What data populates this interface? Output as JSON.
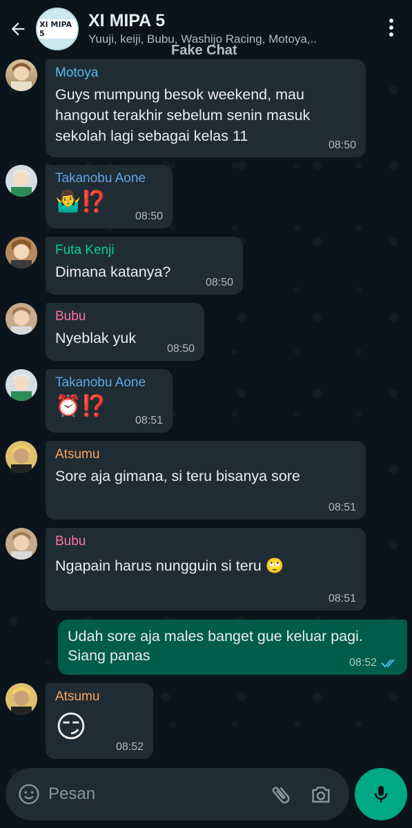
{
  "header": {
    "group_name": "XI MIPA 5",
    "members": "Yuuji, keiji, Bubu, Washijo Racing, Motoya,..",
    "avatar_text": "XI MIPA 5",
    "watermark": "Fake Chat"
  },
  "messages": [
    {
      "sender": "Motoya",
      "text": "Guys mumpung besok weekend, mau hangout terakhir sebelum senin masuk sekolah lagi sebagai kelas 11",
      "time": "08:50",
      "sender_color": "#53bdeb"
    },
    {
      "sender": "Takanobu Aone",
      "text": "🤷‍♂️⁉️",
      "time": "08:50",
      "sender_color": "#5ea4e6"
    },
    {
      "sender": "Futa Kenji",
      "text": "Dimana katanya?",
      "time": "08:50",
      "sender_color": "#06cf9c"
    },
    {
      "sender": "Bubu",
      "text": "Nyeblak yuk",
      "time": "08:50",
      "sender_color": "#ff72a1"
    },
    {
      "sender": "Takanobu Aone",
      "text": "⏰⁉️",
      "time": "08:51",
      "sender_color": "#5ea4e6"
    },
    {
      "sender": "Atsumu",
      "text": "Sore aja gimana, si teru bisanya sore",
      "time": "08:51",
      "sender_color": "#ffa45c"
    },
    {
      "sender": "Bubu",
      "text": "Ngapain harus nungguin si teru 🙄",
      "time": "08:51",
      "sender_color": "#ff72a1"
    },
    {
      "sender": "",
      "text": "Udah sore aja males banget gue keluar pagi. Siang panas",
      "time": "08:52",
      "outgoing": true
    },
    {
      "sender": "Atsumu",
      "text": "😏",
      "time": "08:52",
      "sender_color": "#ffa45c"
    }
  ],
  "input": {
    "placeholder": "Pesan"
  },
  "icons": [
    "back-arrow-icon",
    "more-vert-icon",
    "emoji-icon",
    "attach-icon",
    "camera-icon",
    "mic-icon",
    "double-check-icon"
  ]
}
